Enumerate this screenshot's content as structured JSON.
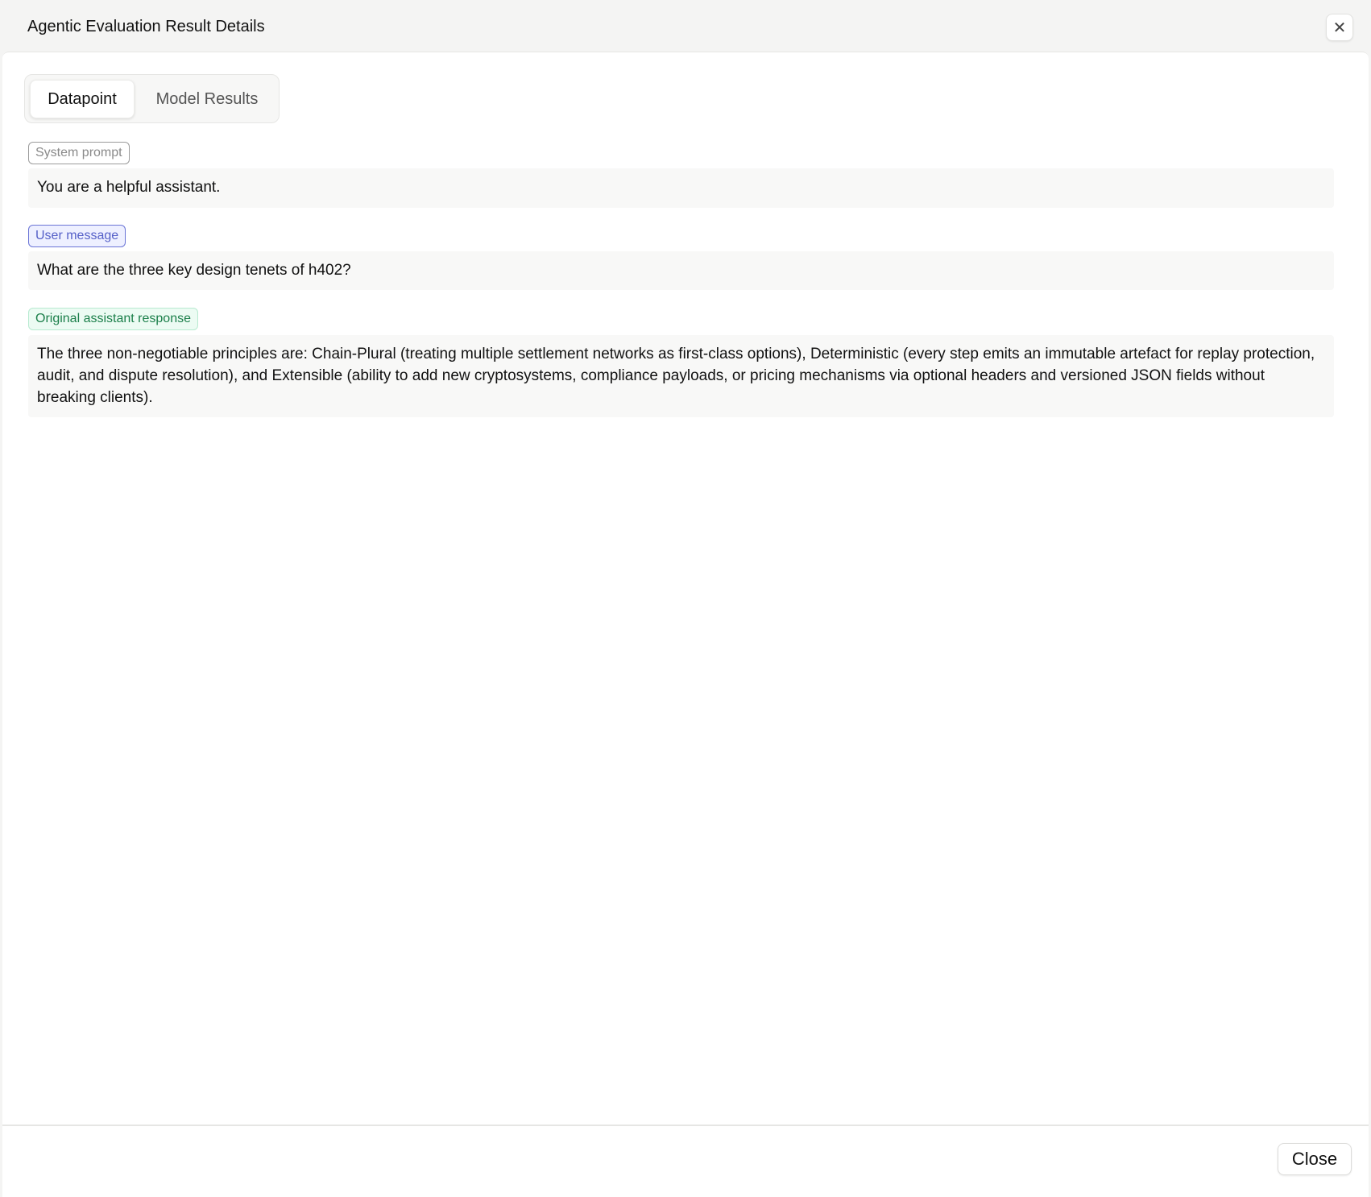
{
  "dialog": {
    "title": "Agentic Evaluation Result Details",
    "close_icon": "close-icon"
  },
  "tabs": [
    {
      "label": "Datapoint",
      "active": true
    },
    {
      "label": "Model Results",
      "active": false
    }
  ],
  "messages": {
    "system": {
      "badge": "System prompt",
      "text": "You are a helpful assistant."
    },
    "user": {
      "badge": "User message",
      "text": "What are the three key design tenets of h402?"
    },
    "assistant": {
      "badge": "Original assistant response",
      "text": "The three non-negotiable principles are: Chain-Plural (treating multiple settlement networks as first-class options), Deterministic (every step emits an immutable artefact for replay protection, audit, and dispute resolution), and Extensible (ability to add new cryptosystems, compliance payloads, or pricing mechanisms via optional headers and versioned JSON fields without breaking clients)."
    }
  },
  "footer": {
    "close_label": "Close"
  },
  "colors": {
    "user_badge": "#5560c8",
    "assistant_badge": "#1b7f4a",
    "system_badge": "#8a8a8a"
  }
}
